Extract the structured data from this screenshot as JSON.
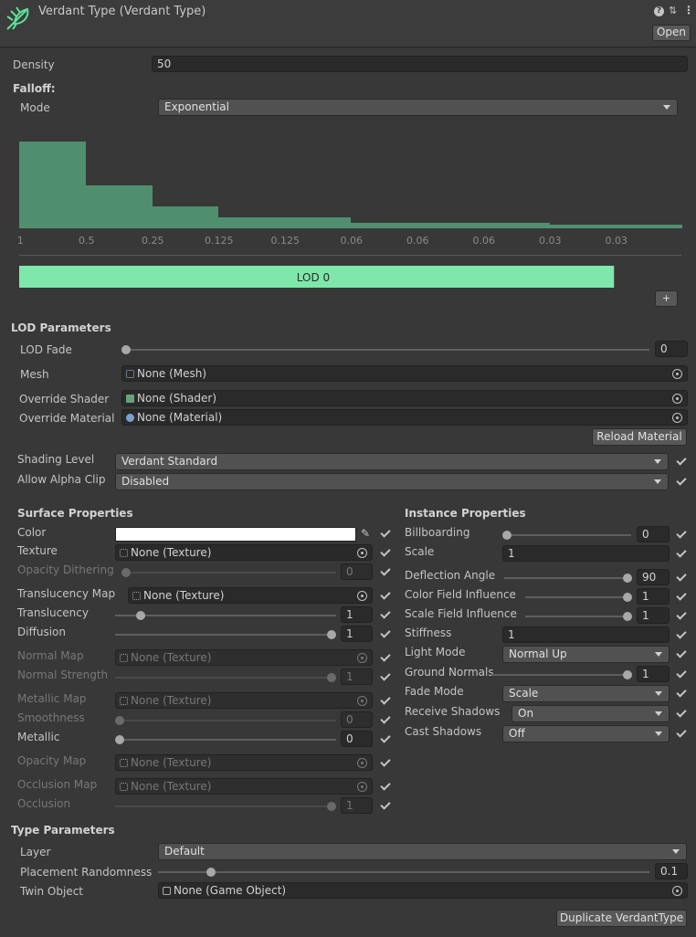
{
  "header": {
    "title": "Verdant Type (Verdant Type)",
    "open_label": "Open",
    "icon_colors": {
      "leaf": "#5ee09a"
    }
  },
  "density": {
    "label": "Density",
    "value": "50"
  },
  "falloff": {
    "heading": "Falloff:",
    "mode_label": "Mode",
    "mode_value": "Exponential",
    "chart_data": {
      "type": "bar",
      "categories": [
        "1",
        "0.5",
        "0.25",
        "0.125",
        "0.125",
        "0.06",
        "0.06",
        "0.06",
        "0.03",
        "0.03"
      ],
      "values": [
        1,
        0.5,
        0.25,
        0.125,
        0.125,
        0.06,
        0.06,
        0.06,
        0.03,
        0.03
      ],
      "title": "",
      "xlabel": "",
      "ylabel": "",
      "ylim": [
        0,
        1
      ],
      "color": "#4f8f6f"
    }
  },
  "lod": {
    "bar_label": "LOD 0",
    "bar_fill_fraction": 0.895,
    "bar_color": "#7ee8ab",
    "add_label": "+"
  },
  "lod_params": {
    "heading": "LOD Parameters",
    "fade_label": "LOD Fade",
    "fade_value": "0",
    "mesh_label": "Mesh",
    "mesh_value": "None (Mesh)",
    "shader_label": "Override Shader",
    "shader_value": "None (Shader)",
    "material_label": "Override Material",
    "material_value": "None (Material)",
    "reload_label": "Reload Material"
  },
  "shading": {
    "level_label": "Shading Level",
    "level_value": "Verdant Standard",
    "alpha_label": "Allow Alpha Clip",
    "alpha_value": "Disabled"
  },
  "surface": {
    "heading": "Surface Properties",
    "color_label": "Color",
    "color_swatch": "#ffffff",
    "texture_label": "Texture",
    "texture_value": "None (Texture)",
    "opacity_dither_label": "Opacity Dithering",
    "opacity_dither_value": "0",
    "trans_map_label": "Translucency Map",
    "trans_map_value": "None (Texture)",
    "translucency_label": "Translucency",
    "translucency_value": "1",
    "diffusion_label": "Diffusion",
    "diffusion_value": "1",
    "normal_map_label": "Normal Map",
    "normal_map_value": "None (Texture)",
    "normal_strength_label": "Normal Strength",
    "normal_strength_value": "1",
    "metallic_map_label": "Metallic Map",
    "metallic_map_value": "None (Texture)",
    "smoothness_label": "Smoothness",
    "smoothness_value": "0",
    "metallic_label": "Metallic",
    "metallic_value": "0",
    "opacity_map_label": "Opacity Map",
    "opacity_map_value": "None (Texture)",
    "occlusion_map_label": "Occlusion Map",
    "occlusion_map_value": "None (Texture)",
    "occlusion_label": "Occlusion",
    "occlusion_value": "1"
  },
  "instance": {
    "heading": "Instance Properties",
    "billboarding_label": "Billboarding",
    "billboarding_value": "0",
    "scale_label": "Scale",
    "scale_value": "1",
    "deflection_label": "Deflection Angle",
    "deflection_value": "90",
    "color_field_label": "Color Field Influence",
    "color_field_value": "1",
    "scale_field_label": "Scale Field Influence",
    "scale_field_value": "1",
    "stiffness_label": "Stiffness",
    "stiffness_value": "1",
    "light_mode_label": "Light Mode",
    "light_mode_value": "Normal Up",
    "ground_normals_label": "Ground Normals",
    "ground_normals_value": "1",
    "fade_mode_label": "Fade Mode",
    "fade_mode_value": "Scale",
    "receive_shadows_label": "Receive Shadows",
    "receive_shadows_value": "On",
    "cast_shadows_label": "Cast Shadows",
    "cast_shadows_value": "Off"
  },
  "type_params": {
    "heading": "Type Parameters",
    "layer_label": "Layer",
    "layer_value": "Default",
    "placement_label": "Placement Randomness",
    "placement_value": "0.1",
    "twin_label": "Twin Object",
    "twin_value": "None (Game Object)",
    "duplicate_label": "Duplicate VerdantType"
  }
}
